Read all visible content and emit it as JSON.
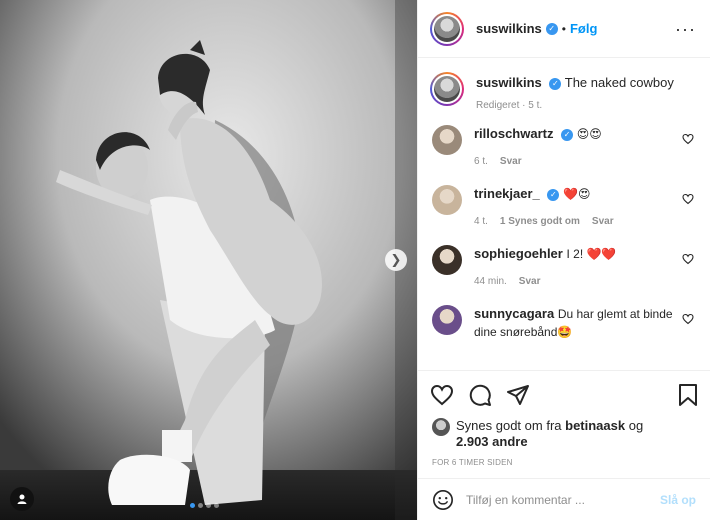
{
  "post": {
    "username": "suswilkins",
    "follow_label": "Følg",
    "dot": "•",
    "more_label": "···"
  },
  "caption": {
    "username": "suswilkins",
    "text": "The naked cowboy",
    "meta": "Redigeret · 5 t."
  },
  "comments": [
    {
      "username": "rilloschwartz",
      "verified": true,
      "text": "😍😍",
      "time": "6 t.",
      "likes": "",
      "reply": "Svar",
      "avatar_color": "#9a8a7a"
    },
    {
      "username": "trinekjaer_",
      "verified": true,
      "text": "❤️😍",
      "time": "4 t.",
      "likes": "1 Synes godt om",
      "reply": "Svar",
      "avatar_color": "#c8b49c"
    },
    {
      "username": "sophiegoehler",
      "verified": false,
      "text": "I 2! ❤️❤️",
      "time": "44 min.",
      "likes": "",
      "reply": "Svar",
      "avatar_color": "#3a3028"
    },
    {
      "username": "sunnycagara",
      "verified": false,
      "text": "Du har glemt at binde dine snørebånd🤩",
      "time": "",
      "likes": "",
      "reply": "",
      "avatar_color": "#6a4e8a"
    }
  ],
  "likes": {
    "prefix": "Synes godt om fra",
    "user": "betinaask",
    "joiner": "og",
    "count": "2.903 andre"
  },
  "ago": "FOR 6 TIMER SIDEN",
  "composer": {
    "placeholder": "Tilføj en kommentar ...",
    "post_label": "Slå op"
  },
  "carousel": {
    "slides": 4,
    "active": 0
  },
  "colors": {
    "accent": "#0095f6",
    "verified": "#3897f0",
    "heart": "#ed4956"
  },
  "icons": [
    "heart-icon",
    "comment-icon",
    "share-icon",
    "save-icon",
    "emoji-icon",
    "more-icon",
    "chevron-right-icon",
    "user-tag-icon",
    "verified-icon"
  ]
}
